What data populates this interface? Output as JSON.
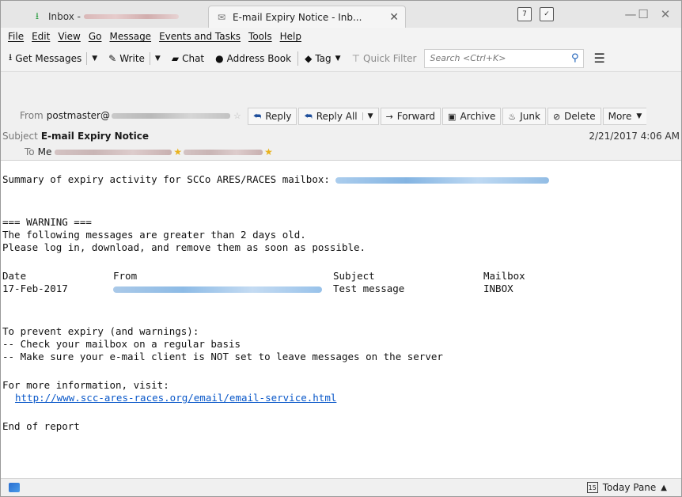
{
  "tabs": [
    {
      "label": "Inbox -",
      "icon": "inbox-download-icon"
    },
    {
      "label": "E-mail Expiry Notice - Inb...",
      "icon": "envelope-icon",
      "close": "✕"
    }
  ],
  "window_controls": {
    "minimize": "—",
    "maximize": "☐",
    "close": "✕"
  },
  "menu": [
    "File",
    "Edit",
    "View",
    "Go",
    "Message",
    "Events and Tasks",
    "Tools",
    "Help"
  ],
  "toolbar": {
    "get_messages": "Get Messages",
    "write": "Write",
    "chat": "Chat",
    "address_book": "Address Book",
    "tag": "Tag",
    "quick_filter": "Quick Filter",
    "search_placeholder": "Search <Ctrl+K>"
  },
  "header": {
    "from_label": "From",
    "from_value": "postmaster@",
    "subject_label": "Subject",
    "subject_value": "E-mail Expiry Notice",
    "date": "2/21/2017 4:06 AM",
    "to_label": "To",
    "to_value": "Me",
    "actions": {
      "reply": "Reply",
      "reply_all": "Reply All",
      "forward": "Forward",
      "archive": "Archive",
      "junk": "Junk",
      "delete": "Delete",
      "more": "More"
    }
  },
  "body": {
    "summary": "Summary of expiry activity for SCCo ARES/RACES mailbox:",
    "warning": "=== WARNING ===",
    "line1": "The following messages are greater than 2 days old.",
    "line2": "Please log in, download, and remove them as soon as possible.",
    "table_header": {
      "date": "Date",
      "from": "From",
      "subject": "Subject",
      "mailbox": "Mailbox"
    },
    "table_row": {
      "date": "17-Feb-2017",
      "subject": "Test message",
      "mailbox": "INBOX"
    },
    "prevent": "To prevent expiry (and warnings):",
    "tip1": "-- Check your mailbox on a regular basis",
    "tip2": "-- Make sure your e-mail client is NOT set to leave messages on the server",
    "more_info": "For more information, visit:",
    "url": "http://www.scc-ares-races.org/email/email-service.html",
    "end": "End of report"
  },
  "status": {
    "today_pane": "Today Pane",
    "calendar_day": "15"
  }
}
